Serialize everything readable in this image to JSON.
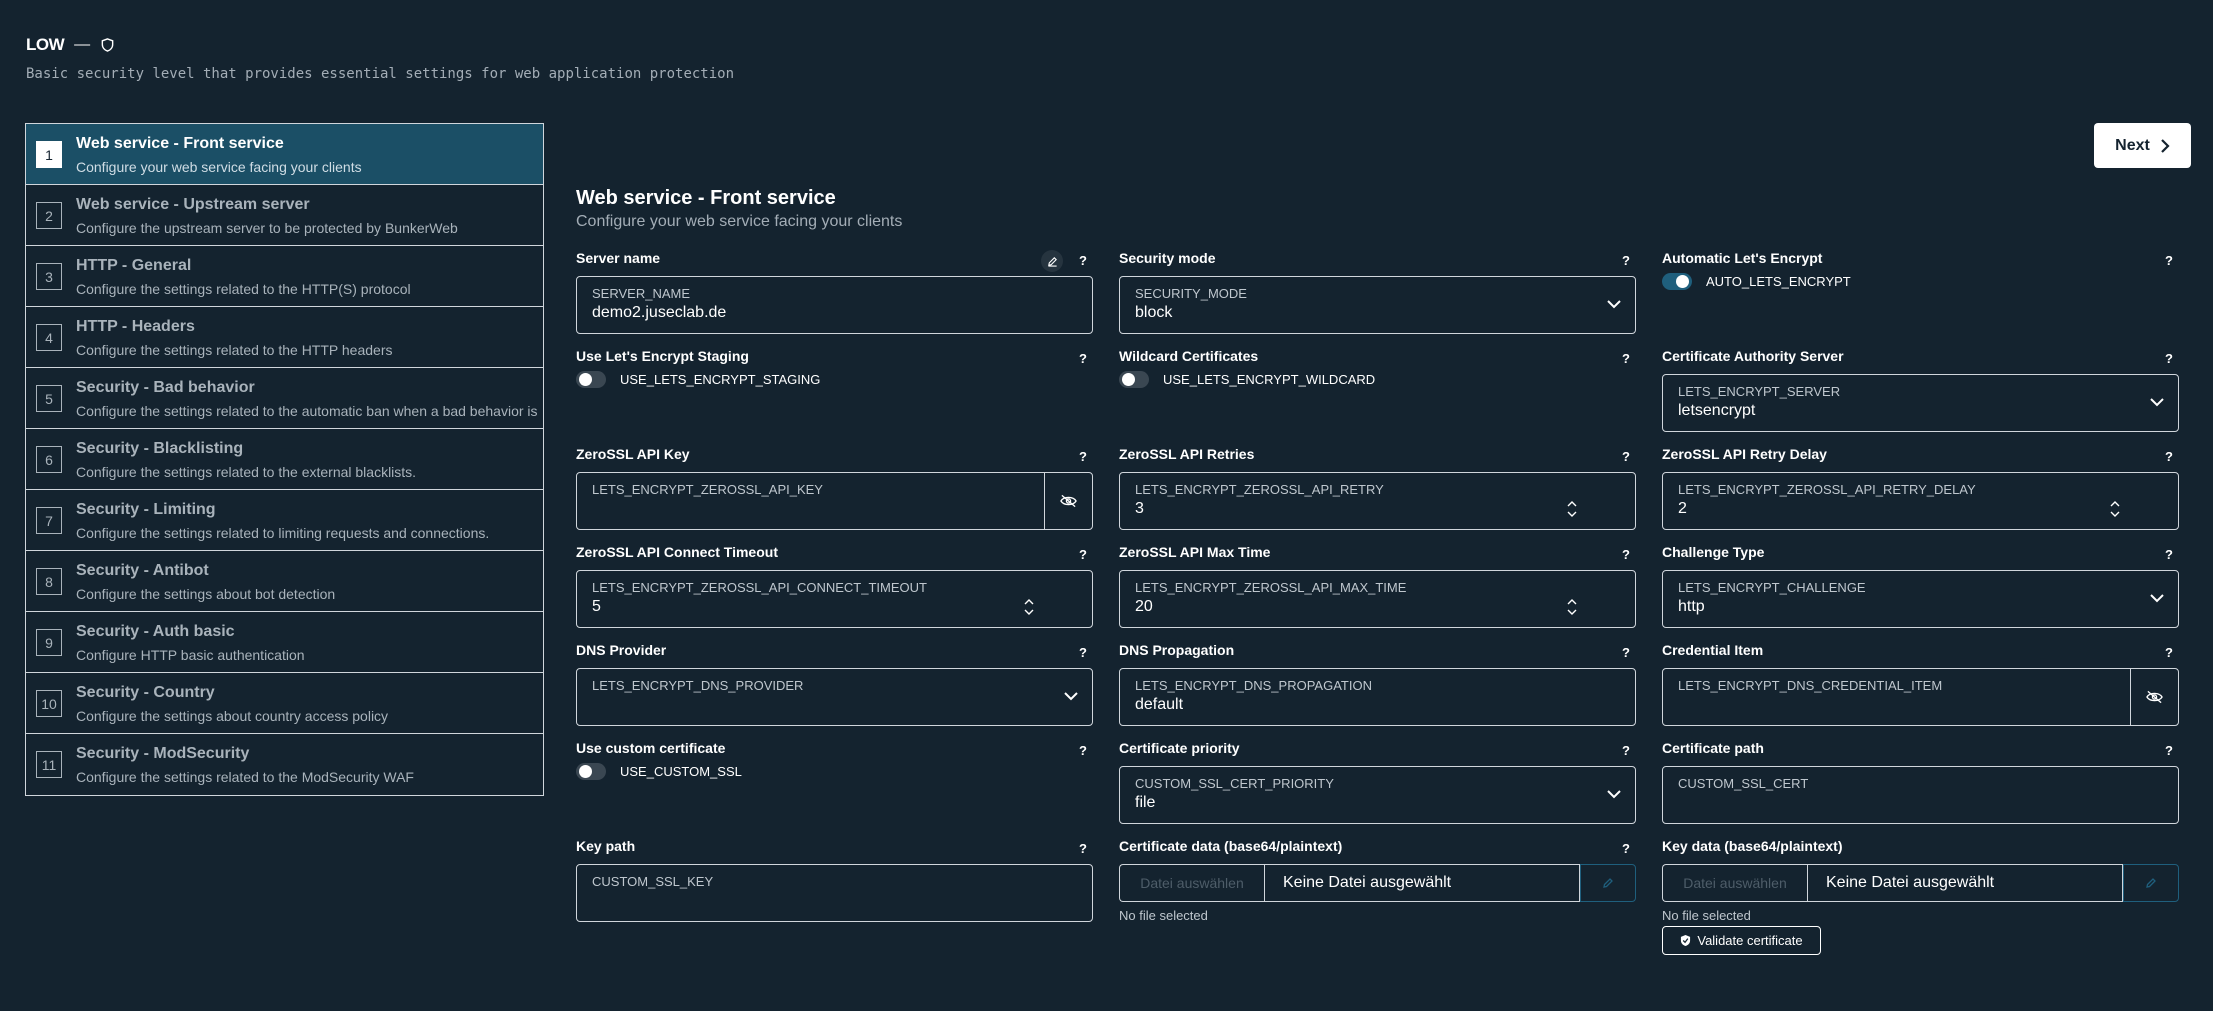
{
  "header": {
    "level_title": "LOW",
    "dash": "—",
    "description": "Basic security level that provides essential settings for web application protection"
  },
  "steps": [
    {
      "num": "1",
      "title": "Web service - Front service",
      "desc": "Configure your web service facing your clients"
    },
    {
      "num": "2",
      "title": "Web service - Upstream server",
      "desc": "Configure the upstream server to be protected by BunkerWeb"
    },
    {
      "num": "3",
      "title": "HTTP - General",
      "desc": "Configure the settings related to the HTTP(S) protocol"
    },
    {
      "num": "4",
      "title": "HTTP - Headers",
      "desc": "Configure the settings related to the HTTP headers"
    },
    {
      "num": "5",
      "title": "Security - Bad behavior",
      "desc": "Configure the settings related to the automatic ban when a bad behavior is d"
    },
    {
      "num": "6",
      "title": "Security - Blacklisting",
      "desc": "Configure the settings related to the external blacklists."
    },
    {
      "num": "7",
      "title": "Security - Limiting",
      "desc": "Configure the settings related to limiting requests and connections."
    },
    {
      "num": "8",
      "title": "Security - Antibot",
      "desc": "Configure the settings about bot detection"
    },
    {
      "num": "9",
      "title": "Security - Auth basic",
      "desc": "Configure HTTP basic authentication"
    },
    {
      "num": "10",
      "title": "Security - Country",
      "desc": "Configure the settings about country access policy"
    },
    {
      "num": "11",
      "title": "Security - ModSecurity",
      "desc": "Configure the settings related to the ModSecurity WAF"
    }
  ],
  "next_label": "Next",
  "form": {
    "title": "Web service - Front service",
    "subtitle": "Configure your web service facing your clients",
    "help": "?",
    "server_name": {
      "label": "Server name",
      "name": "SERVER_NAME",
      "value": "demo2.juseclab.de"
    },
    "security_mode": {
      "label": "Security mode",
      "name": "SECURITY_MODE",
      "value": "block"
    },
    "auto_le": {
      "label": "Automatic Let's Encrypt",
      "name": "AUTO_LETS_ENCRYPT",
      "checked": true
    },
    "le_staging": {
      "label": "Use Let's Encrypt Staging",
      "name": "USE_LETS_ENCRYPT_STAGING",
      "checked": false
    },
    "wildcard": {
      "label": "Wildcard Certificates",
      "name": "USE_LETS_ENCRYPT_WILDCARD",
      "checked": false
    },
    "ca_server": {
      "label": "Certificate Authority Server",
      "name": "LETS_ENCRYPT_SERVER",
      "value": "letsencrypt"
    },
    "zerossl_key": {
      "label": "ZeroSSL API Key",
      "name": "LETS_ENCRYPT_ZEROSSL_API_KEY",
      "value": ""
    },
    "zerossl_retry": {
      "label": "ZeroSSL API Retries",
      "name": "LETS_ENCRYPT_ZEROSSL_API_RETRY",
      "value": "3"
    },
    "zerossl_retry_delay": {
      "label": "ZeroSSL API Retry Delay",
      "name": "LETS_ENCRYPT_ZEROSSL_API_RETRY_DELAY",
      "value": "2"
    },
    "zerossl_connect_timeout": {
      "label": "ZeroSSL API Connect Timeout",
      "name": "LETS_ENCRYPT_ZEROSSL_API_CONNECT_TIMEOUT",
      "value": "5"
    },
    "zerossl_max_time": {
      "label": "ZeroSSL API Max Time",
      "name": "LETS_ENCRYPT_ZEROSSL_API_MAX_TIME",
      "value": "20"
    },
    "challenge": {
      "label": "Challenge Type",
      "name": "LETS_ENCRYPT_CHALLENGE",
      "value": "http"
    },
    "dns_provider": {
      "label": "DNS Provider",
      "name": "LETS_ENCRYPT_DNS_PROVIDER",
      "value": ""
    },
    "dns_propagation": {
      "label": "DNS Propagation",
      "name": "LETS_ENCRYPT_DNS_PROPAGATION",
      "value": "default"
    },
    "credential_item": {
      "label": "Credential Item",
      "name": "LETS_ENCRYPT_DNS_CREDENTIAL_ITEM",
      "value": ""
    },
    "custom_cert": {
      "label": "Use custom certificate",
      "name": "USE_CUSTOM_SSL",
      "checked": false
    },
    "cert_priority": {
      "label": "Certificate priority",
      "name": "CUSTOM_SSL_CERT_PRIORITY",
      "value": "file"
    },
    "cert_path": {
      "label": "Certificate path",
      "name": "CUSTOM_SSL_CERT",
      "value": ""
    },
    "key_path": {
      "label": "Key path",
      "name": "CUSTOM_SSL_KEY",
      "value": ""
    },
    "cert_data": {
      "label": "Certificate data (base64/plaintext)",
      "choose": "Datei auswählen",
      "file_name": "Keine Datei ausgewählt",
      "no_file": "No file selected"
    },
    "key_data": {
      "label": "Key data (base64/plaintext)",
      "choose": "Datei auswählen",
      "file_name": "Keine Datei ausgewählt",
      "no_file": "No file selected"
    },
    "validate_label": "Validate certificate"
  },
  "colors": {
    "background": "#14232f",
    "active_step": "#1b4f66",
    "accent": "#1f5f7d"
  }
}
